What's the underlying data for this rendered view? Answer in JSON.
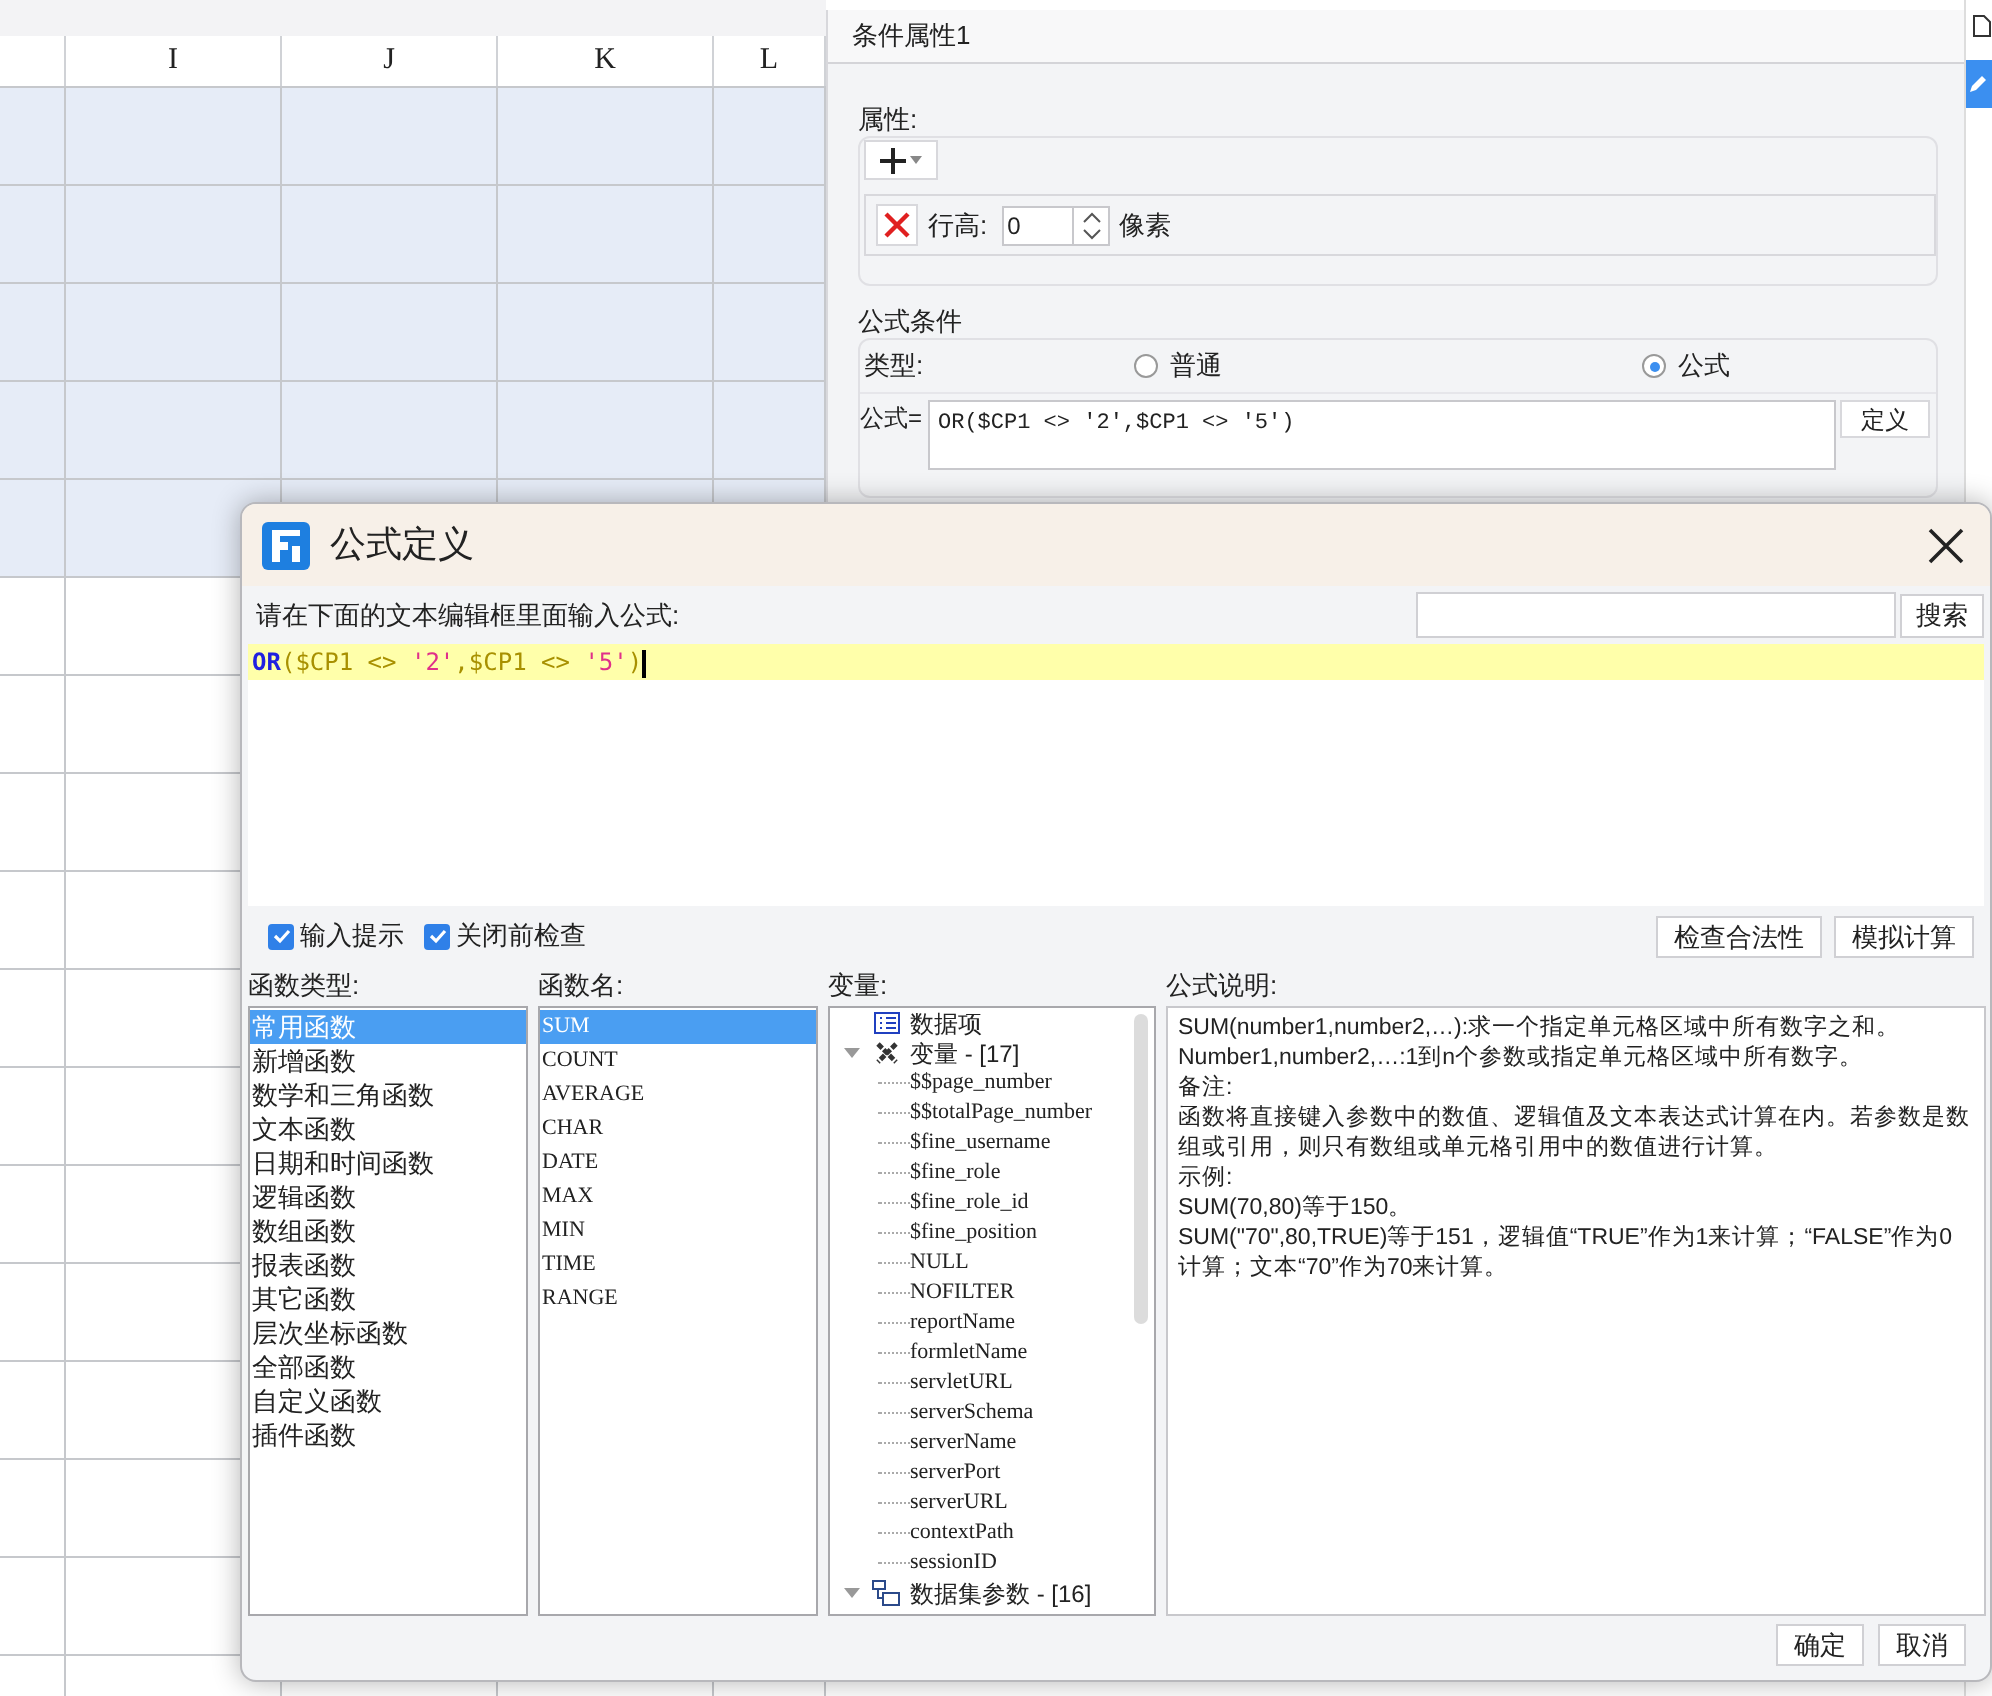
{
  "spreadsheet": {
    "column_headers": [
      "I",
      "J",
      "K",
      "L"
    ]
  },
  "condition_panel": {
    "title": "条件属性1",
    "property_group": {
      "label": "属性:",
      "row_height_label": "行高:",
      "row_height_value": "0",
      "unit": "像素"
    },
    "formula_condition": {
      "label": "公式条件",
      "type_label": "类型:",
      "types": [
        {
          "label": "普通",
          "selected": false
        },
        {
          "label": "公式",
          "selected": true
        }
      ],
      "formula_label": "公式=",
      "formula": "OR($CP1 <> '2',$CP1 <> '5')",
      "define_button": "定义"
    }
  },
  "dialog": {
    "title": "公式定义",
    "prompt": "请在下面的文本编辑框里面输入公式:",
    "search_button": "搜索",
    "formula_tokens": [
      {
        "text": "OR",
        "kind": "function"
      },
      {
        "text": "(",
        "kind": "symbol"
      },
      {
        "text": "$CP1 <> ",
        "kind": "symbol"
      },
      {
        "text": "'2'",
        "kind": "string"
      },
      {
        "text": ",",
        "kind": "symbol"
      },
      {
        "text": "$CP1 <> ",
        "kind": "symbol"
      },
      {
        "text": "'5'",
        "kind": "string"
      },
      {
        "text": ")",
        "kind": "symbol"
      }
    ],
    "options": [
      {
        "label": "输入提示",
        "checked": true
      },
      {
        "label": "关闭前检查",
        "checked": true
      }
    ],
    "action_buttons": [
      "检查合法性",
      "模拟计算"
    ],
    "function_types": {
      "label": "函数类型:",
      "items": [
        {
          "label": "常用函数",
          "selected": true
        },
        {
          "label": "新增函数",
          "selected": false
        },
        {
          "label": "数学和三角函数",
          "selected": false
        },
        {
          "label": "文本函数",
          "selected": false
        },
        {
          "label": "日期和时间函数",
          "selected": false
        },
        {
          "label": "逻辑函数",
          "selected": false
        },
        {
          "label": "数组函数",
          "selected": false
        },
        {
          "label": "报表函数",
          "selected": false
        },
        {
          "label": "其它函数",
          "selected": false
        },
        {
          "label": "层次坐标函数",
          "selected": false
        },
        {
          "label": "全部函数",
          "selected": false
        },
        {
          "label": "自定义函数",
          "selected": false
        },
        {
          "label": "插件函数",
          "selected": false
        }
      ]
    },
    "function_names": {
      "label": "函数名:",
      "items": [
        {
          "label": "SUM",
          "selected": true
        },
        {
          "label": "COUNT",
          "selected": false
        },
        {
          "label": "AVERAGE",
          "selected": false
        },
        {
          "label": "CHAR",
          "selected": false
        },
        {
          "label": "DATE",
          "selected": false
        },
        {
          "label": "MAX",
          "selected": false
        },
        {
          "label": "MIN",
          "selected": false
        },
        {
          "label": "TIME",
          "selected": false
        },
        {
          "label": "RANGE",
          "selected": false
        }
      ]
    },
    "variables": {
      "label": "变量:",
      "items": [
        {
          "label": "数据项",
          "kind": "data"
        },
        {
          "label": "变量 - [17]",
          "kind": "variables",
          "expanded": true,
          "children": [
            {
              "label": "$$page_number"
            },
            {
              "label": "$$totalPage_number"
            },
            {
              "label": "$fine_username"
            },
            {
              "label": "$fine_role"
            },
            {
              "label": "$fine_role_id"
            },
            {
              "label": "$fine_position"
            },
            {
              "label": "NULL"
            },
            {
              "label": "NOFILTER"
            },
            {
              "label": "reportName"
            },
            {
              "label": "formletName"
            },
            {
              "label": "servletURL"
            },
            {
              "label": "serverSchema"
            },
            {
              "label": "serverName"
            },
            {
              "label": "serverPort"
            },
            {
              "label": "serverURL"
            },
            {
              "label": "contextPath"
            },
            {
              "label": "sessionID"
            }
          ]
        },
        {
          "label": "数据集参数 - [16]",
          "kind": "dataset",
          "expanded": true
        }
      ]
    },
    "description": {
      "label": "公式说明:",
      "lines": [
        "SUM(number1,number2,…):求一个指定单元格区域中所有数字之和。",
        "Number1,number2,…:1到n个参数或指定单元格区域中所有数字。",
        "备注:",
        "函数将直接键入参数中的数值、逻辑值及文本表达式计算在内。若参数是数组或引用，则只有数组或单元格引用中的数值进行计算。",
        "示例:",
        "SUM(70,80)等于150。",
        "SUM(\"70\",80,TRUE)等于151，逻辑值“TRUE”作为1来计算；“FALSE”作为0计算；文本“70”作为70来计算。"
      ]
    },
    "footer_buttons": [
      "确定",
      "取消"
    ]
  }
}
